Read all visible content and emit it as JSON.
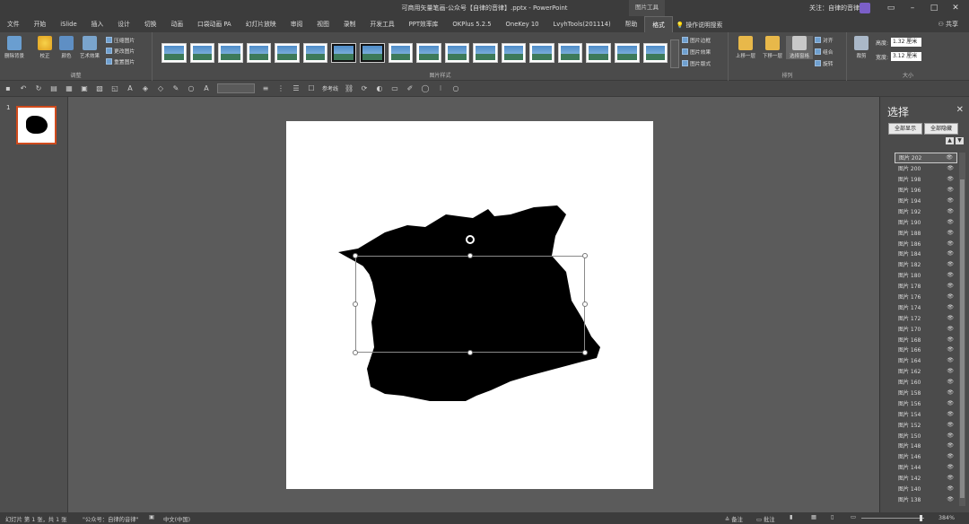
{
  "window": {
    "title": "可商用矢量笔画-公众号【自律的音律】.pptx - PowerPoint",
    "context_tab": "图片工具",
    "account": "关注：自律的音律",
    "share": "共享",
    "tell_me": "操作说明搜索"
  },
  "tabs": [
    "文件",
    "开始",
    "iSlide",
    "插入",
    "设计",
    "切换",
    "动画",
    "口袋动画 PA",
    "幻灯片放映",
    "审阅",
    "视图",
    "录制",
    "开发工具",
    "PPT效率库",
    "OKPlus 5.2.5",
    "OneKey 10",
    "LvyhTools(201114)",
    "帮助",
    "格式"
  ],
  "ribbon": {
    "adjust": {
      "label": "调整",
      "remove_bg": "删除背景",
      "correct": "校正",
      "color": "颜色",
      "artistic": "艺术效果",
      "compress": "压缩图片",
      "change": "更改图片",
      "reset": "重置图片"
    },
    "styles": {
      "label": "图片样式",
      "border": "图片边框",
      "effects": "图片效果",
      "layout": "图片版式"
    },
    "arrange": {
      "label": "排列",
      "forward": "上移一层",
      "backward": "下移一层",
      "selection_pane": "选择窗格",
      "align": "对齐",
      "group": "组合",
      "rotate": "旋转"
    },
    "size": {
      "label": "大小",
      "crop": "裁剪",
      "height_label": "高度:",
      "height": "1.32 厘米",
      "width_label": "宽度:",
      "width": "3.12 厘米"
    }
  },
  "qat": {
    "ref_line": "参考线"
  },
  "slide_panel": {
    "slide_number": "1"
  },
  "selection_pane": {
    "title": "选择",
    "show_all": "全部显示",
    "hide_all": "全部隐藏",
    "items": [
      "图片 202",
      "图片 200",
      "图片 198",
      "图片 196",
      "图片 194",
      "图片 192",
      "图片 190",
      "图片 188",
      "图片 186",
      "图片 184",
      "图片 182",
      "图片 180",
      "图片 178",
      "图片 176",
      "图片 174",
      "图片 172",
      "图片 170",
      "图片 168",
      "图片 166",
      "图片 164",
      "图片 162",
      "图片 160",
      "图片 158",
      "图片 156",
      "图片 154",
      "图片 152",
      "图片 150",
      "图片 148",
      "图片 146",
      "图片 144",
      "图片 142",
      "图片 140",
      "图片 138"
    ]
  },
  "status": {
    "slide_info": "幻灯片 第 1 张，共 1 张",
    "theme": "\"公众号：自律的音律\"",
    "language": "中文(中国)",
    "notes": "备注",
    "comments": "批注",
    "zoom": "384%"
  },
  "colors": {
    "accent": "#d04a1c",
    "dark_bg": "#3c3c3c",
    "ribbon_bg": "#4b4b4b"
  }
}
